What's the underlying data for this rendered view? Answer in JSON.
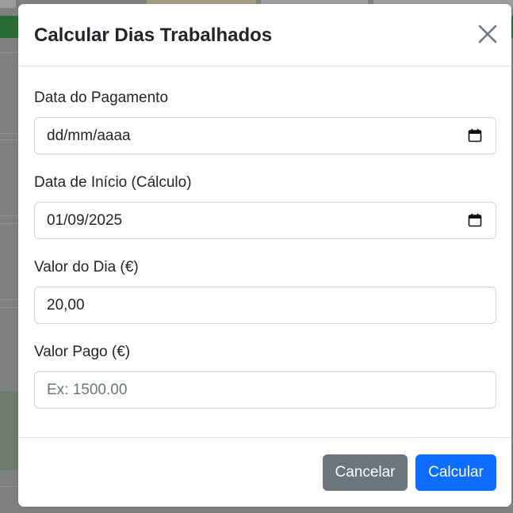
{
  "modal": {
    "title": "Calcular Dias Trabalhados",
    "close_icon": "close-icon"
  },
  "fields": {
    "payment_date": {
      "label": "Data do Pagamento",
      "placeholder": "dd/mm/aaaa",
      "value": "",
      "icon": "calendar-icon"
    },
    "start_date": {
      "label": "Data de Início (Cálculo)",
      "value": "01/09/2025",
      "icon": "calendar-icon"
    },
    "day_value": {
      "label": "Valor do Dia (€)",
      "value": "20,00"
    },
    "paid_value": {
      "label": "Valor Pago (€)",
      "placeholder": "Ex: 1500.00",
      "value": ""
    }
  },
  "footer": {
    "cancel_label": "Cancelar",
    "calculate_label": "Calcular"
  },
  "colors": {
    "primary": "#0d6efd",
    "secondary": "#6c757d",
    "backdrop": "#7d7f80",
    "text": "#212529"
  }
}
